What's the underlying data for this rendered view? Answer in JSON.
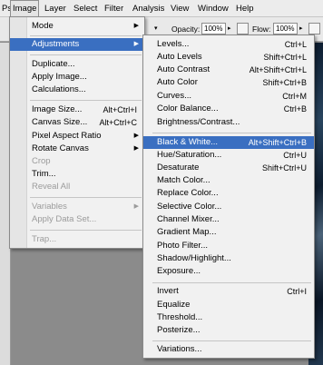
{
  "menubar": {
    "items": [
      "Ps",
      "Image",
      "Layer",
      "Select",
      "Filter",
      "Analysis",
      "View",
      "Window",
      "Help"
    ]
  },
  "options_bar": {
    "opacity_label": "Opacity:",
    "opacity_value": "100%",
    "flow_label": "Flow:",
    "flow_value": "100%"
  },
  "image_menu": {
    "items": [
      {
        "label": "Mode",
        "shortcut": "",
        "submenu": true,
        "disabled": false
      },
      {
        "label": "Adjustments",
        "shortcut": "",
        "submenu": true,
        "disabled": false,
        "highlighted": true
      },
      {
        "label": "Duplicate...",
        "shortcut": "",
        "submenu": false,
        "disabled": false
      },
      {
        "label": "Apply Image...",
        "shortcut": "",
        "submenu": false,
        "disabled": false
      },
      {
        "label": "Calculations...",
        "shortcut": "",
        "submenu": false,
        "disabled": false
      },
      {
        "label": "Image Size...",
        "shortcut": "Alt+Ctrl+I",
        "submenu": false,
        "disabled": false
      },
      {
        "label": "Canvas Size...",
        "shortcut": "Alt+Ctrl+C",
        "submenu": false,
        "disabled": false
      },
      {
        "label": "Pixel Aspect Ratio",
        "shortcut": "",
        "submenu": true,
        "disabled": false
      },
      {
        "label": "Rotate Canvas",
        "shortcut": "",
        "submenu": true,
        "disabled": false
      },
      {
        "label": "Crop",
        "shortcut": "",
        "submenu": false,
        "disabled": true
      },
      {
        "label": "Trim...",
        "shortcut": "",
        "submenu": false,
        "disabled": false
      },
      {
        "label": "Reveal All",
        "shortcut": "",
        "submenu": false,
        "disabled": true
      },
      {
        "label": "Variables",
        "shortcut": "",
        "submenu": true,
        "disabled": true
      },
      {
        "label": "Apply Data Set...",
        "shortcut": "",
        "submenu": false,
        "disabled": true
      },
      {
        "label": "Trap...",
        "shortcut": "",
        "submenu": false,
        "disabled": true
      }
    ]
  },
  "adjustments_menu": {
    "items": [
      {
        "label": "Levels...",
        "shortcut": "Ctrl+L"
      },
      {
        "label": "Auto Levels",
        "shortcut": "Shift+Ctrl+L"
      },
      {
        "label": "Auto Contrast",
        "shortcut": "Alt+Shift+Ctrl+L"
      },
      {
        "label": "Auto Color",
        "shortcut": "Shift+Ctrl+B"
      },
      {
        "label": "Curves...",
        "shortcut": "Ctrl+M"
      },
      {
        "label": "Color Balance...",
        "shortcut": "Ctrl+B"
      },
      {
        "label": "Brightness/Contrast...",
        "shortcut": ""
      },
      {
        "label": "Black & White...",
        "shortcut": "Alt+Shift+Ctrl+B",
        "highlighted": true
      },
      {
        "label": "Hue/Saturation...",
        "shortcut": "Ctrl+U"
      },
      {
        "label": "Desaturate",
        "shortcut": "Shift+Ctrl+U"
      },
      {
        "label": "Match Color...",
        "shortcut": ""
      },
      {
        "label": "Replace Color...",
        "shortcut": ""
      },
      {
        "label": "Selective Color...",
        "shortcut": ""
      },
      {
        "label": "Channel Mixer...",
        "shortcut": ""
      },
      {
        "label": "Gradient Map...",
        "shortcut": ""
      },
      {
        "label": "Photo Filter...",
        "shortcut": ""
      },
      {
        "label": "Shadow/Highlight...",
        "shortcut": ""
      },
      {
        "label": "Exposure...",
        "shortcut": ""
      },
      {
        "label": "Invert",
        "shortcut": "Ctrl+I"
      },
      {
        "label": "Equalize",
        "shortcut": ""
      },
      {
        "label": "Threshold...",
        "shortcut": ""
      },
      {
        "label": "Posterize...",
        "shortcut": ""
      },
      {
        "label": "Variations...",
        "shortcut": ""
      }
    ]
  },
  "colors": {
    "highlight": "#3a6fc1",
    "menu_bg": "#f1f1f1",
    "disabled_text": "#9b9b9b"
  }
}
